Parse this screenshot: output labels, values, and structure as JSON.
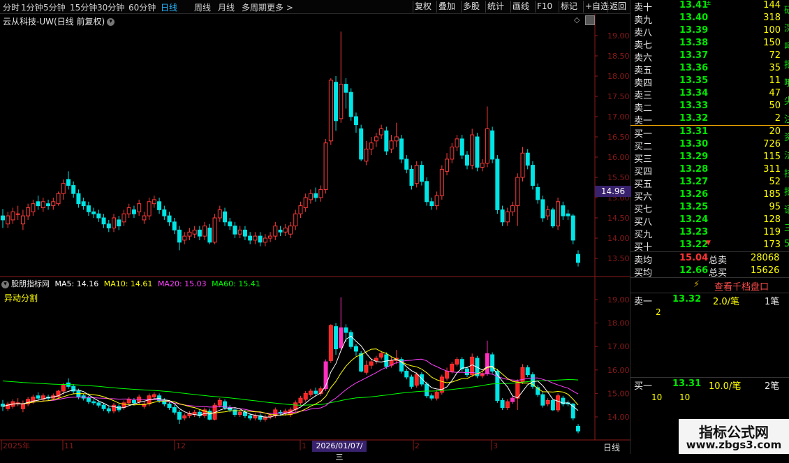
{
  "toolbar": {
    "tabs": [
      "分时",
      "1分钟",
      "5分钟",
      "15分钟",
      "30分钟",
      "60分钟",
      "日线",
      "周线",
      "月线",
      "多周期",
      "更多 >"
    ],
    "active": "日线",
    "right_buttons": [
      "复权",
      "叠加",
      "多股",
      "统计",
      "画线",
      "F10",
      "标记",
      "+自选",
      "返回"
    ]
  },
  "chart": {
    "title": "云从科技-UW(日线 前复权)",
    "price_marker": "14.96",
    "y_ticks": [
      "19.00",
      "18.50",
      "18.00",
      "17.50",
      "17.00",
      "16.50",
      "16.00",
      "15.50",
      "15.00",
      "14.50",
      "14.00",
      "13.50"
    ],
    "lower_y_ticks": [
      "19.00",
      "18.00",
      "17.00",
      "16.00",
      "15.00",
      "14.00"
    ],
    "x_labels": [
      "2025年",
      "11",
      "12",
      "1",
      "2",
      "3"
    ],
    "date_marker": "2026/01/07/三",
    "period_label": "日线"
  },
  "indicator": {
    "name": "股朋指标网",
    "ma5": "MA5: 14.16",
    "ma10": "MA10: 14.61",
    "ma20": "MA20: 15.03",
    "ma60": "MA60: 15.41",
    "sub_label": "异动分割"
  },
  "orderbook": {
    "asks": [
      {
        "label": "卖十",
        "price": "13.41",
        "vol": "144",
        "mark": "±"
      },
      {
        "label": "卖九",
        "price": "13.40",
        "vol": "318"
      },
      {
        "label": "卖八",
        "price": "13.39",
        "vol": "100"
      },
      {
        "label": "卖七",
        "price": "13.38",
        "vol": "150"
      },
      {
        "label": "卖六",
        "price": "13.37",
        "vol": "72"
      },
      {
        "label": "卖五",
        "price": "13.36",
        "vol": "35"
      },
      {
        "label": "卖四",
        "price": "13.35",
        "vol": "11"
      },
      {
        "label": "卖三",
        "price": "13.34",
        "vol": "47"
      },
      {
        "label": "卖二",
        "price": "13.33",
        "vol": "50"
      },
      {
        "label": "卖一",
        "price": "13.32",
        "vol": "2"
      }
    ],
    "bids": [
      {
        "label": "买一",
        "price": "13.31",
        "vol": "20"
      },
      {
        "label": "买二",
        "price": "13.30",
        "vol": "726"
      },
      {
        "label": "买三",
        "price": "13.29",
        "vol": "115"
      },
      {
        "label": "买四",
        "price": "13.28",
        "vol": "311"
      },
      {
        "label": "买五",
        "price": "13.27",
        "vol": "52"
      },
      {
        "label": "买六",
        "price": "13.26",
        "vol": "185"
      },
      {
        "label": "买七",
        "price": "13.25",
        "vol": "95"
      },
      {
        "label": "买八",
        "price": "13.24",
        "vol": "128"
      },
      {
        "label": "买九",
        "price": "13.23",
        "vol": "119"
      },
      {
        "label": "买十",
        "price": "13.22",
        "vol": "173",
        "mark": "▼"
      }
    ],
    "avg_sell_label": "卖均",
    "avg_sell_price": "15.04",
    "total_sell_label": "总卖",
    "total_sell": "28068",
    "avg_buy_label": "买均",
    "avg_buy_price": "12.66",
    "total_buy_label": "总买",
    "total_buy": "15626",
    "thousand_btn": "查看千档盘口",
    "detail_ask_label": "卖一",
    "detail_ask_price": "13.32",
    "detail_ask_vol": "2.0/笔",
    "detail_ask_count": "1笔",
    "detail_ask_sub": "2",
    "detail_bid_label": "买一",
    "detail_bid_price": "13.31",
    "detail_bid_vol": "10.0/笔",
    "detail_bid_count": "2笔",
    "detail_bid_sub1": "10",
    "detail_bid_sub2": "10"
  },
  "side_text": [
    "研",
    "深",
    "呵",
    "批",
    "哦",
    "尖",
    "注",
    "资",
    "法",
    "拉",
    "批",
    "语",
    "三",
    "5"
  ],
  "watermark": {
    "line1": "指标公式网",
    "line2": "www.zbgs3.com"
  },
  "colors": {
    "up": "#ff3b3b",
    "down": "#00e5e5",
    "pink": "#ff2fbf",
    "ma5": "#ffffff",
    "ma10": "#ffff00",
    "ma20": "#ff40ff",
    "ma60": "#00ff00",
    "grid": "#8b1a1a"
  },
  "chart_data": {
    "type": "candlestick",
    "candles": [
      [
        14.55,
        14.45,
        14.72,
        14.25
      ],
      [
        14.35,
        14.55,
        14.65,
        14.25
      ],
      [
        14.45,
        14.65,
        14.75,
        14.35
      ],
      [
        14.6,
        14.6,
        14.8,
        14.45
      ],
      [
        14.35,
        14.55,
        14.7,
        14.2
      ],
      [
        14.55,
        14.75,
        14.85,
        14.45
      ],
      [
        14.65,
        14.85,
        14.95,
        14.55
      ],
      [
        14.9,
        14.8,
        15.05,
        14.7
      ],
      [
        14.75,
        14.9,
        15.0,
        14.65
      ],
      [
        14.85,
        14.8,
        14.95,
        14.7
      ],
      [
        14.8,
        14.9,
        15.0,
        14.7
      ],
      [
        14.85,
        15.1,
        15.15,
        14.8
      ],
      [
        15.1,
        15.35,
        15.45,
        14.95
      ],
      [
        15.45,
        15.3,
        15.65,
        15.2
      ],
      [
        15.3,
        15.1,
        15.4,
        15.0
      ],
      [
        15.1,
        14.85,
        15.2,
        14.75
      ],
      [
        14.9,
        14.8,
        15.0,
        14.7
      ],
      [
        14.8,
        14.65,
        14.9,
        14.55
      ],
      [
        14.65,
        14.6,
        14.75,
        14.5
      ],
      [
        14.6,
        14.5,
        14.7,
        14.4
      ],
      [
        14.5,
        14.35,
        14.6,
        14.25
      ],
      [
        14.35,
        14.25,
        14.45,
        14.15
      ],
      [
        14.25,
        14.5,
        14.6,
        14.15
      ],
      [
        14.45,
        14.3,
        14.55,
        14.2
      ],
      [
        14.4,
        14.6,
        14.7,
        14.3
      ],
      [
        14.6,
        14.75,
        14.85,
        14.5
      ],
      [
        14.7,
        14.6,
        14.8,
        14.5
      ],
      [
        14.65,
        14.85,
        14.95,
        14.55
      ],
      [
        14.45,
        14.55,
        14.65,
        14.35
      ],
      [
        14.55,
        14.9,
        15.0,
        14.45
      ],
      [
        14.85,
        14.95,
        15.05,
        14.75
      ],
      [
        14.9,
        14.7,
        15.0,
        14.6
      ],
      [
        14.7,
        14.55,
        14.8,
        14.45
      ],
      [
        14.55,
        14.4,
        14.65,
        14.3
      ],
      [
        14.4,
        14.2,
        14.5,
        14.1
      ],
      [
        14.2,
        13.9,
        14.3,
        13.7
      ],
      [
        13.95,
        14.05,
        14.15,
        13.85
      ],
      [
        14.05,
        14.15,
        14.25,
        13.95
      ],
      [
        14.1,
        14.2,
        14.3,
        14.0
      ],
      [
        14.2,
        14.05,
        14.3,
        13.95
      ],
      [
        14.05,
        14.3,
        14.4,
        13.95
      ],
      [
        14.25,
        13.9,
        14.35,
        13.85
      ],
      [
        13.9,
        14.5,
        14.6,
        13.85
      ],
      [
        14.5,
        14.7,
        14.8,
        14.4
      ],
      [
        14.65,
        14.4,
        14.75,
        14.3
      ],
      [
        14.4,
        14.3,
        14.5,
        14.2
      ],
      [
        14.3,
        14.1,
        14.4,
        14.0
      ],
      [
        14.1,
        14.2,
        14.3,
        14.0
      ],
      [
        14.2,
        14.05,
        14.3,
        13.95
      ],
      [
        14.05,
        13.95,
        14.15,
        13.85
      ],
      [
        13.95,
        14.05,
        14.15,
        13.85
      ],
      [
        14.05,
        13.9,
        14.15,
        13.8
      ],
      [
        13.9,
        14.0,
        14.1,
        13.8
      ],
      [
        14.0,
        14.05,
        14.15,
        13.9
      ],
      [
        14.05,
        14.3,
        14.4,
        13.95
      ],
      [
        14.2,
        14.15,
        14.3,
        14.05
      ],
      [
        14.15,
        14.25,
        14.35,
        14.05
      ],
      [
        14.1,
        14.3,
        14.4,
        14.0
      ],
      [
        14.3,
        14.6,
        14.7,
        14.2
      ],
      [
        14.6,
        14.8,
        14.9,
        14.5
      ],
      [
        14.75,
        15.0,
        15.1,
        14.65
      ],
      [
        14.95,
        15.1,
        15.2,
        14.85
      ],
      [
        15.1,
        15.0,
        15.25,
        14.9
      ],
      [
        15.0,
        15.2,
        15.3,
        14.9
      ],
      [
        15.2,
        16.35,
        16.45,
        15.1
      ],
      [
        16.4,
        17.9,
        17.95,
        16.3
      ],
      [
        17.85,
        16.9,
        18.0,
        16.65
      ],
      [
        16.95,
        17.8,
        19.1,
        16.85
      ],
      [
        17.8,
        17.6,
        17.95,
        17.2
      ],
      [
        17.6,
        17.0,
        17.7,
        16.9
      ],
      [
        17.0,
        16.8,
        17.1,
        16.6
      ],
      [
        16.7,
        15.95,
        16.8,
        15.9
      ],
      [
        15.9,
        16.2,
        16.4,
        15.8
      ],
      [
        16.2,
        16.35,
        16.5,
        16.05
      ],
      [
        16.4,
        16.5,
        16.6,
        16.25
      ],
      [
        16.55,
        16.7,
        16.8,
        16.45
      ],
      [
        16.65,
        16.15,
        16.75,
        16.05
      ],
      [
        16.2,
        16.4,
        16.55,
        16.1
      ],
      [
        16.4,
        16.5,
        16.85,
        16.25
      ],
      [
        16.45,
        15.95,
        16.55,
        15.85
      ],
      [
        15.95,
        15.7,
        16.05,
        15.6
      ],
      [
        15.7,
        15.3,
        15.8,
        15.2
      ],
      [
        15.35,
        15.8,
        15.9,
        15.25
      ],
      [
        15.8,
        15.4,
        15.9,
        15.3
      ],
      [
        15.4,
        14.9,
        15.5,
        14.8
      ],
      [
        14.9,
        14.8,
        15.0,
        14.7
      ],
      [
        14.8,
        15.05,
        15.15,
        14.7
      ],
      [
        15.05,
        15.7,
        15.8,
        14.95
      ],
      [
        15.65,
        15.95,
        16.1,
        15.55
      ],
      [
        15.95,
        16.25,
        16.35,
        15.85
      ],
      [
        16.25,
        16.45,
        16.55,
        16.15
      ],
      [
        16.45,
        16.05,
        16.55,
        15.95
      ],
      [
        16.05,
        15.8,
        16.15,
        15.7
      ],
      [
        15.8,
        16.55,
        16.7,
        15.7
      ],
      [
        16.5,
        15.75,
        16.6,
        15.65
      ],
      [
        15.75,
        15.85,
        15.95,
        15.65
      ],
      [
        15.85,
        16.7,
        17.25,
        15.75
      ],
      [
        16.65,
        15.95,
        16.75,
        15.85
      ],
      [
        15.95,
        14.7,
        16.05,
        14.6
      ],
      [
        14.7,
        14.4,
        14.8,
        14.3
      ],
      [
        14.4,
        14.65,
        14.75,
        14.3
      ],
      [
        14.65,
        14.8,
        14.9,
        14.55
      ],
      [
        14.8,
        15.5,
        15.6,
        14.3
      ],
      [
        15.5,
        16.1,
        16.25,
        15.4
      ],
      [
        16.1,
        15.8,
        16.2,
        15.7
      ],
      [
        15.8,
        15.3,
        15.9,
        15.2
      ],
      [
        15.25,
        14.95,
        15.35,
        14.85
      ],
      [
        14.95,
        14.5,
        15.05,
        14.4
      ],
      [
        14.55,
        14.7,
        14.8,
        14.45
      ],
      [
        14.7,
        14.3,
        14.75,
        14.25
      ],
      [
        14.3,
        14.9,
        15.0,
        14.2
      ],
      [
        14.8,
        14.55,
        14.9,
        14.45
      ],
      [
        14.6,
        14.55,
        14.7,
        14.45
      ],
      [
        14.55,
        13.95,
        14.6,
        13.85
      ],
      [
        13.6,
        13.4,
        13.7,
        13.3
      ]
    ],
    "ylim": [
      13.35,
      19.35
    ]
  }
}
